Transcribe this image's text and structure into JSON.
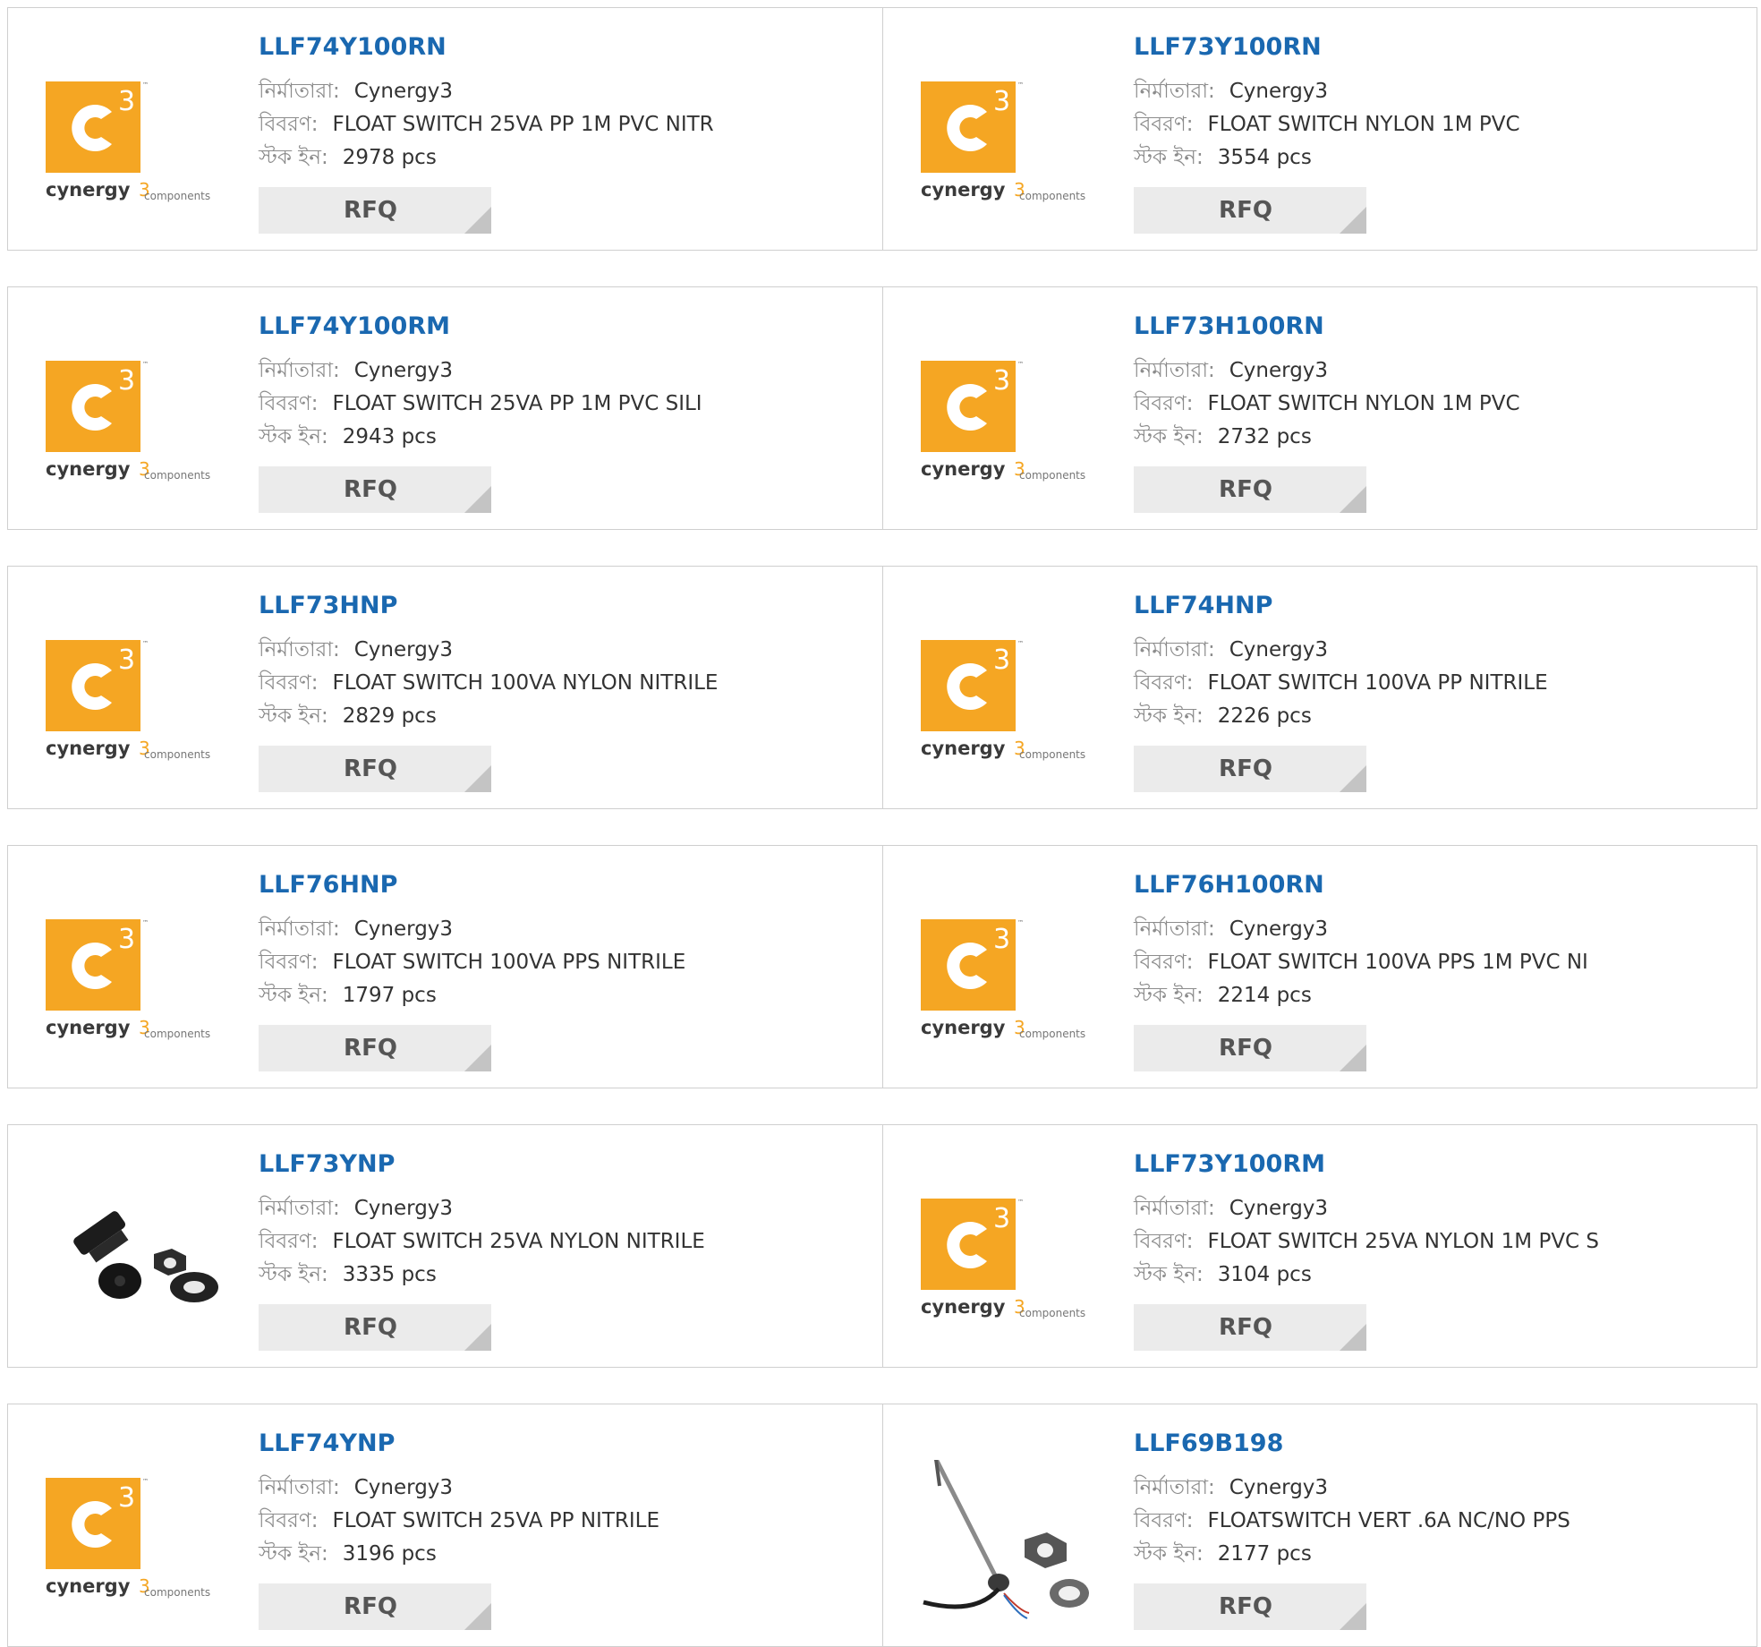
{
  "labels": {
    "manufacturer": "নির্মাতারা:",
    "description": "বিবরণ:",
    "stock": "স্টক ইন:"
  },
  "logo": {
    "mark": "3",
    "tm": "™",
    "word": "cynergy",
    "sub_mark": "3",
    "sub_word": "components",
    "brand_color": "#f5a623"
  },
  "colors": {
    "link": "#1a68b0",
    "label": "#8c8c8c",
    "border": "#cfcfcf",
    "button": "#ebebeb"
  },
  "rows": [
    {
      "left": {
        "part": "LLF74Y100RN",
        "manufacturer": "Cynergy3",
        "description": "FLOAT SWITCH 25VA PP 1M PVC NITR",
        "stock": "2978 pcs",
        "rfq": "RFQ",
        "image": "cynergy3-logo"
      },
      "right": {
        "part": "LLF73Y100RN",
        "manufacturer": "Cynergy3",
        "description": "FLOAT SWITCH NYLON 1M PVC",
        "stock": "3554 pcs",
        "rfq": "RFQ",
        "image": "cynergy3-logo"
      }
    },
    {
      "left": {
        "part": "LLF74Y100RM",
        "manufacturer": "Cynergy3",
        "description": "FLOAT SWITCH 25VA PP 1M PVC SILI",
        "stock": "2943 pcs",
        "rfq": "RFQ",
        "image": "cynergy3-logo"
      },
      "right": {
        "part": "LLF73H100RN",
        "manufacturer": "Cynergy3",
        "description": "FLOAT SWITCH NYLON 1M PVC",
        "stock": "2732 pcs",
        "rfq": "RFQ",
        "image": "cynergy3-logo"
      }
    },
    {
      "left": {
        "part": "LLF73HNP",
        "manufacturer": "Cynergy3",
        "description": "FLOAT SWITCH 100VA NYLON NITRILE",
        "stock": "2829 pcs",
        "rfq": "RFQ",
        "image": "cynergy3-logo"
      },
      "right": {
        "part": "LLF74HNP",
        "manufacturer": "Cynergy3",
        "description": "FLOAT SWITCH 100VA PP NITRILE",
        "stock": "2226 pcs",
        "rfq": "RFQ",
        "image": "cynergy3-logo"
      }
    },
    {
      "left": {
        "part": "LLF76HNP",
        "manufacturer": "Cynergy3",
        "description": "FLOAT SWITCH 100VA PPS NITRILE",
        "stock": "1797 pcs",
        "rfq": "RFQ",
        "image": "cynergy3-logo"
      },
      "right": {
        "part": "LLF76H100RN",
        "manufacturer": "Cynergy3",
        "description": "FLOAT SWITCH 100VA PPS 1M PVC NI",
        "stock": "2214 pcs",
        "rfq": "RFQ",
        "image": "cynergy3-logo"
      }
    },
    {
      "left": {
        "part": "LLF73YNP",
        "manufacturer": "Cynergy3",
        "description": "FLOAT SWITCH 25VA NYLON NITRILE",
        "stock": "3335 pcs",
        "rfq": "RFQ",
        "image": "float-switch-black-photo"
      },
      "right": {
        "part": "LLF73Y100RM",
        "manufacturer": "Cynergy3",
        "description": "FLOAT SWITCH 25VA NYLON 1M PVC S",
        "stock": "3104 pcs",
        "rfq": "RFQ",
        "image": "cynergy3-logo"
      }
    },
    {
      "left": {
        "part": "LLF74YNP",
        "manufacturer": "Cynergy3",
        "description": "FLOAT SWITCH 25VA PP NITRILE",
        "stock": "3196 pcs",
        "rfq": "RFQ",
        "image": "cynergy3-logo"
      },
      "right": {
        "part": "LLF69B198",
        "manufacturer": "Cynergy3",
        "description": "FLOATSWITCH VERT .6A NC/NO PPS",
        "stock": "2177 pcs",
        "rfq": "RFQ",
        "image": "float-switch-vertical-photo"
      }
    }
  ]
}
